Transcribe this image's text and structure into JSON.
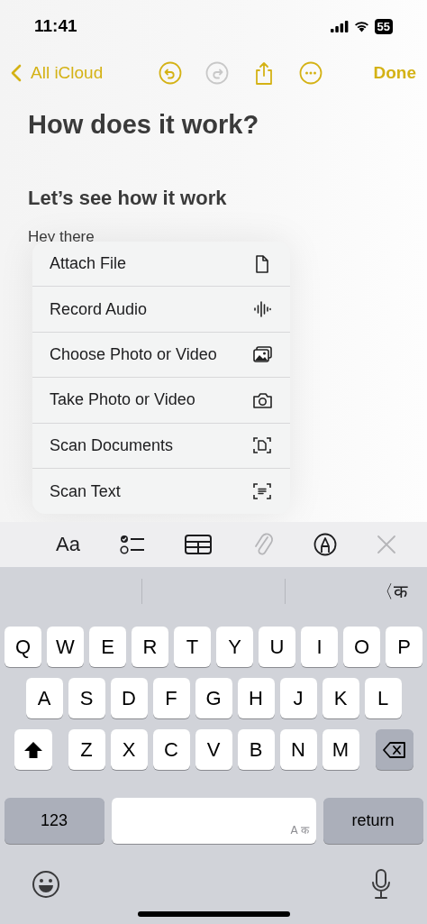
{
  "status_bar": {
    "time": "11:41",
    "battery": "55"
  },
  "nav": {
    "back": "All iCloud",
    "actions": [
      {
        "kind": "undo",
        "disabled": false
      },
      {
        "kind": "redo",
        "disabled": true
      },
      {
        "kind": "share",
        "disabled": false
      },
      {
        "kind": "more",
        "disabled": false
      }
    ],
    "done": "Done"
  },
  "note": {
    "title": "How does it work?",
    "heading": "Let’s see how it work",
    "body": "Hey there"
  },
  "attach_menu": [
    {
      "label": "Attach File",
      "kind": "file"
    },
    {
      "label": "Record Audio",
      "kind": "audio"
    },
    {
      "label": "Choose Photo or Video",
      "kind": "library"
    },
    {
      "label": "Take Photo or Video",
      "kind": "camera"
    },
    {
      "label": "Scan Documents",
      "kind": "scan"
    },
    {
      "label": "Scan Text",
      "kind": "ocr"
    }
  ],
  "toolbar": [
    {
      "kind": "text",
      "label": "Aa",
      "disabled": false
    },
    {
      "kind": "checklist",
      "disabled": false
    },
    {
      "kind": "table",
      "disabled": false
    },
    {
      "kind": "attach",
      "disabled": true
    },
    {
      "kind": "markup",
      "disabled": false
    },
    {
      "kind": "close",
      "disabled": true
    }
  ],
  "keyboard": {
    "suggestion": "〈क",
    "rows": [
      [
        "Q",
        "W",
        "E",
        "R",
        "T",
        "Y",
        "U",
        "I",
        "O",
        "P"
      ],
      [
        "A",
        "S",
        "D",
        "F",
        "G",
        "H",
        "J",
        "K",
        "L"
      ],
      [
        "Z",
        "X",
        "C",
        "V",
        "B",
        "N",
        "M"
      ]
    ],
    "numbers": "123",
    "space": "A क",
    "return": "return"
  }
}
